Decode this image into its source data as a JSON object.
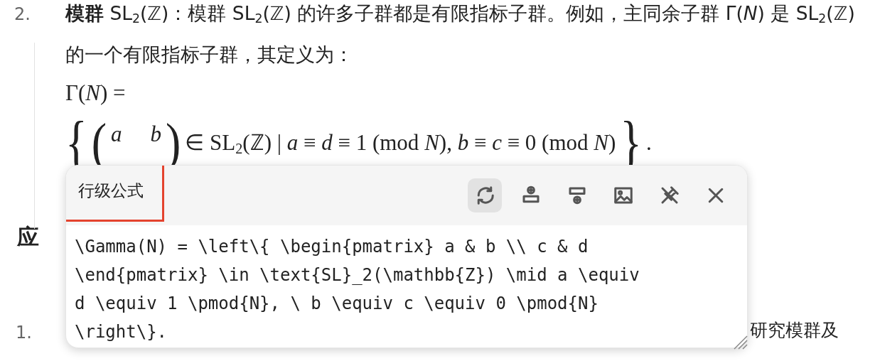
{
  "list_item_2": {
    "number": "2.",
    "text": "**模群** SL$_{2}$(ℤ)：模群 SL$_{2}$(ℤ) 的许多子群都是有限指标子群。例如，主同余子群 Γ(*N*) 是 SL$_{2}$(ℤ) 的一个有限指标子群，其定义为：",
    "formula_lhs": "Γ(*N*) =",
    "set_open": "{",
    "matrix_open": "(",
    "matrix_close": ")",
    "set_close": "}",
    "matrix_top_row": [
      "*a*",
      "*b*"
    ],
    "formula_rest": "∈ SL$_{2}$(ℤ) | *a* ≡ *d* ≡ 1 (mod *N*), *b* ≡ *c* ≡ 0 (mod *N*)",
    "formula_end": "."
  },
  "heading": "应",
  "list_item_1": {
    "number": "1.",
    "text": "研究模群及"
  },
  "formula_popup": {
    "title": "行级公式",
    "title_highlighted": true,
    "tools": [
      {
        "kind": "refresh",
        "selected": true
      },
      {
        "kind": "insert-above",
        "selected": false
      },
      {
        "kind": "insert-below",
        "selected": false
      },
      {
        "kind": "image",
        "selected": false
      },
      {
        "kind": "unpin",
        "selected": false
      },
      {
        "kind": "close",
        "selected": false
      }
    ],
    "code_lines": [
      "\\Gamma(N) = \\left\\{ \\begin{pmatrix} a & b \\\\ c & d",
      "\\end{pmatrix} \\in \\text{SL}_2(\\mathbb{Z}) \\mid a \\equiv",
      "d \\equiv 1 \\pmod{N}, \\ b \\equiv c \\equiv 0 \\pmod{N}",
      "\\right\\}."
    ]
  }
}
